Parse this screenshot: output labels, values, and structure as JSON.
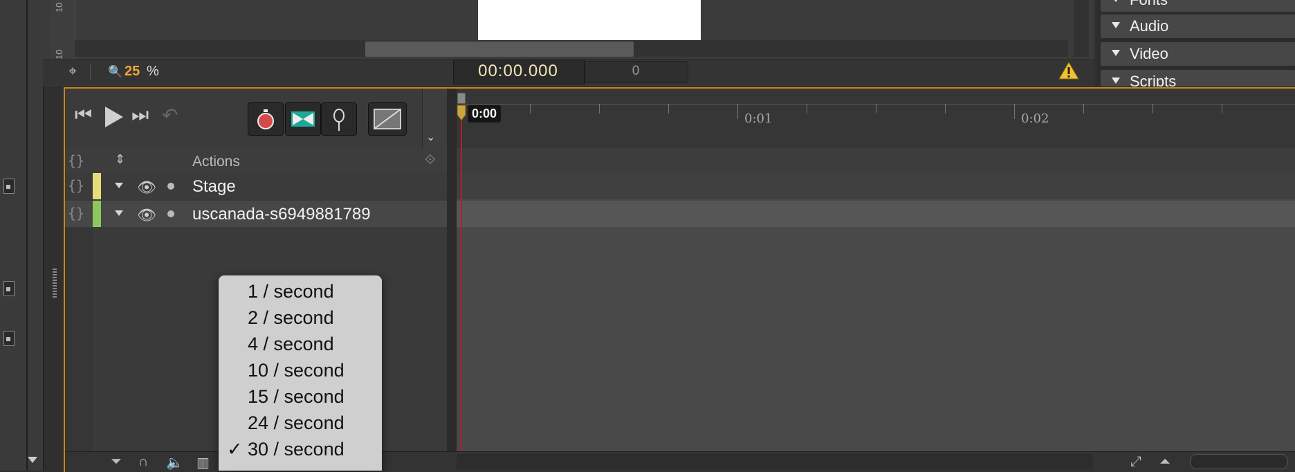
{
  "stage": {
    "ruler_v_labels": [
      "10",
      "10"
    ],
    "zoom_value": "25",
    "zoom_unit": "%",
    "time": "00:00.000",
    "frame": "0"
  },
  "right_panel": {
    "items": [
      {
        "label": "Fonts"
      },
      {
        "label": "Audio"
      },
      {
        "label": "Video"
      },
      {
        "label": "Scripts"
      }
    ]
  },
  "timeline": {
    "actions_header": "Actions",
    "layers": [
      {
        "name": "Stage",
        "color": "#e8dc7a"
      },
      {
        "name": "uscanada-s6949881789",
        "color": "#8fc85a"
      }
    ],
    "playhead_label": "0:00",
    "ruler_labels": [
      "0:01",
      "0:02"
    ]
  },
  "fps_menu": {
    "options": [
      {
        "label": "1 / second",
        "checked": false
      },
      {
        "label": "2 / second",
        "checked": false
      },
      {
        "label": "4 / second",
        "checked": false
      },
      {
        "label": "10 / second",
        "checked": false
      },
      {
        "label": "15 / second",
        "checked": false
      },
      {
        "label": "24 / second",
        "checked": false
      },
      {
        "label": "30 / second",
        "checked": true
      }
    ],
    "check_mark": "✓"
  },
  "colors": {
    "accent_orange": "#f0a830",
    "timeline_border": "#c9861d",
    "playhead_red": "#b81e1e"
  },
  "icons": [
    "target-icon",
    "zoom-icon",
    "warning-icon",
    "skip-back-icon",
    "play-icon",
    "skip-forward-icon",
    "undo-icon",
    "stopwatch-icon",
    "transition-icon",
    "pin-icon",
    "easing-icon",
    "chevron-down-icon",
    "eye-icon",
    "filter-icon",
    "magnet-icon",
    "speaker-icon",
    "columns-icon",
    "expand-icon"
  ]
}
